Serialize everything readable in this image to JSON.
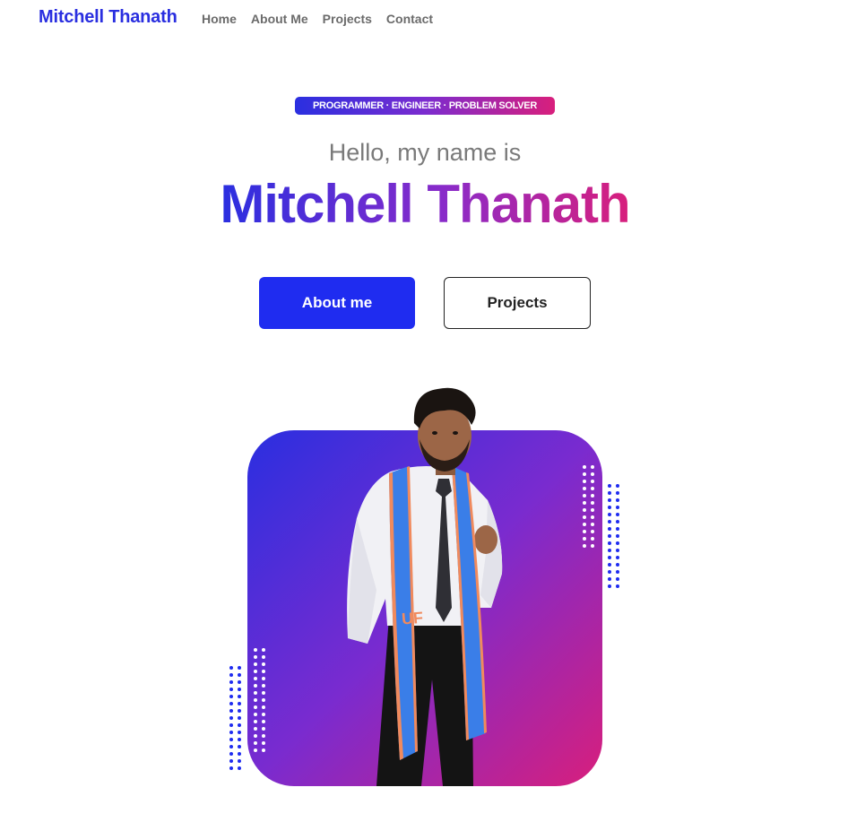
{
  "nav": {
    "brand": "Mitchell Thanath",
    "links": [
      "Home",
      "About Me",
      "Projects",
      "Contact"
    ]
  },
  "hero": {
    "tagline": "PROGRAMMER · ENGINEER · PROBLEM SOLVER",
    "greeting": "Hello, my name is",
    "name": "Mitchell Thanath",
    "primary_button": "About me",
    "secondary_button": "Projects"
  },
  "portrait": {
    "badge_text": "UF"
  },
  "colors": {
    "brand": "#2a2fe0",
    "gradient_start": "#2a2fe0",
    "gradient_mid": "#7a2bcf",
    "gradient_end": "#d81f7c",
    "primary_button": "#1f2cf0"
  }
}
